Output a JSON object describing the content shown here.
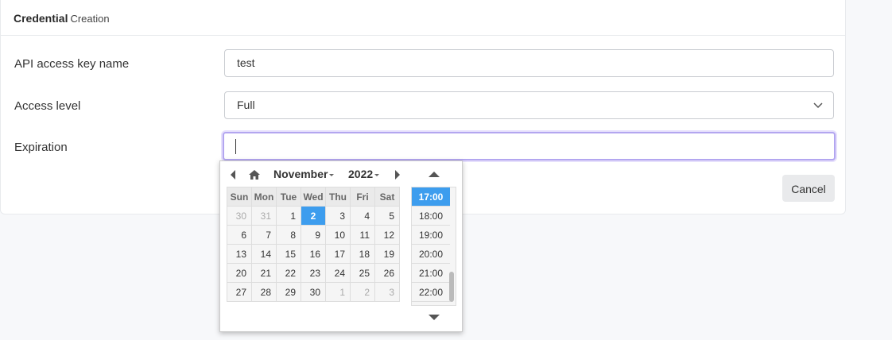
{
  "card": {
    "title_bold": "Credential",
    "title_rest": "Creation"
  },
  "form": {
    "name_label": "API access key name",
    "name_value": "test",
    "access_label": "Access level",
    "access_value": "Full",
    "expiration_label": "Expiration",
    "expiration_value": ""
  },
  "actions": {
    "cancel_label": "Cancel"
  },
  "picker": {
    "month": "November",
    "year": "2022",
    "weekdays": [
      "Sun",
      "Mon",
      "Tue",
      "Wed",
      "Thu",
      "Fri",
      "Sat"
    ],
    "weeks": [
      [
        "30",
        "31",
        "1",
        "2",
        "3",
        "4",
        "5"
      ],
      [
        "6",
        "7",
        "8",
        "9",
        "10",
        "11",
        "12"
      ],
      [
        "13",
        "14",
        "15",
        "16",
        "17",
        "18",
        "19"
      ],
      [
        "20",
        "21",
        "22",
        "23",
        "24",
        "25",
        "26"
      ],
      [
        "27",
        "28",
        "29",
        "30",
        "1",
        "2",
        "3"
      ]
    ],
    "selected_day": "2",
    "times": [
      "17:00",
      "18:00",
      "19:00",
      "20:00",
      "21:00",
      "22:00"
    ],
    "selected_time": "17:00"
  },
  "colors": {
    "accent": "#3d9dee",
    "focus_border": "#b3a6f0"
  }
}
